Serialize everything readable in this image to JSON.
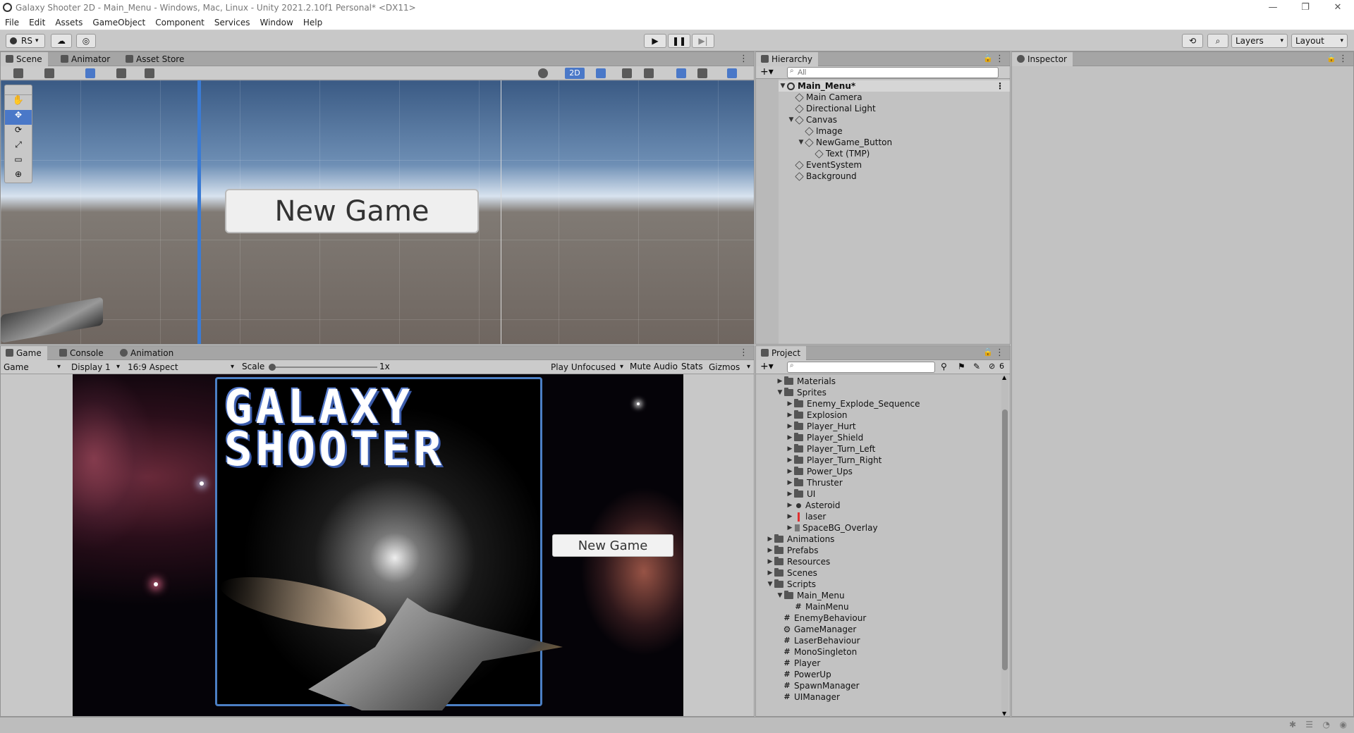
{
  "window": {
    "title": "Galaxy Shooter 2D - Main_Menu - Windows, Mac, Linux - Unity 2021.2.10f1 Personal* <DX11>"
  },
  "menu": [
    "File",
    "Edit",
    "Assets",
    "GameObject",
    "Component",
    "Services",
    "Window",
    "Help"
  ],
  "toolbar": {
    "account": "RS",
    "layers": "Layers",
    "layout": "Layout"
  },
  "scene_tabs": [
    "Scene",
    "Animator",
    "Asset Store"
  ],
  "scene": {
    "toggle_2d": "2D",
    "button_text": "New Game"
  },
  "hierarchy": {
    "tab": "Hierarchy",
    "search_placeholder": "All",
    "items": [
      {
        "label": "Main_Menu*"
      },
      {
        "label": "Main Camera"
      },
      {
        "label": "Directional Light"
      },
      {
        "label": "Canvas"
      },
      {
        "label": "Image"
      },
      {
        "label": "NewGame_Button"
      },
      {
        "label": "Text (TMP)"
      },
      {
        "label": "EventSystem"
      },
      {
        "label": "Background"
      }
    ]
  },
  "inspector": {
    "tab": "Inspector"
  },
  "game_tabs": [
    "Game",
    "Console",
    "Animation"
  ],
  "game_toolbar": {
    "mode": "Game",
    "display": "Display 1",
    "aspect": "16:9 Aspect",
    "scale_label": "Scale",
    "scale_value": "1x",
    "play_mode": "Play Unfocused",
    "mute": "Mute Audio",
    "stats": "Stats",
    "gizmos": "Gizmos"
  },
  "game_view": {
    "title_line1": "GALAXY",
    "title_line2": "SHOOTER",
    "button_text": "New Game"
  },
  "project": {
    "tab": "Project",
    "hidden_count": "6",
    "items": [
      {
        "label": "Materials"
      },
      {
        "label": "Sprites"
      },
      {
        "label": "Enemy_Explode_Sequence"
      },
      {
        "label": "Explosion"
      },
      {
        "label": "Player_Hurt"
      },
      {
        "label": "Player_Shield"
      },
      {
        "label": "Player_Turn_Left"
      },
      {
        "label": "Player_Turn_Right"
      },
      {
        "label": "Power_Ups"
      },
      {
        "label": "Thruster"
      },
      {
        "label": "UI"
      },
      {
        "label": "Asteroid"
      },
      {
        "label": "laser"
      },
      {
        "label": "SpaceBG_Overlay"
      },
      {
        "label": "Animations"
      },
      {
        "label": "Prefabs"
      },
      {
        "label": "Resources"
      },
      {
        "label": "Scenes"
      },
      {
        "label": "Scripts"
      },
      {
        "label": "Main_Menu"
      },
      {
        "label": "MainMenu"
      },
      {
        "label": "EnemyBehaviour"
      },
      {
        "label": "GameManager"
      },
      {
        "label": "LaserBehaviour"
      },
      {
        "label": "MonoSingleton"
      },
      {
        "label": "Player"
      },
      {
        "label": "PowerUp"
      },
      {
        "label": "SpawnManager"
      },
      {
        "label": "UIManager"
      }
    ]
  },
  "colors": {
    "accent": "#3a7bd5",
    "panel_bg": "#c2c2c2",
    "tab_bar": "#a5a5a5"
  }
}
